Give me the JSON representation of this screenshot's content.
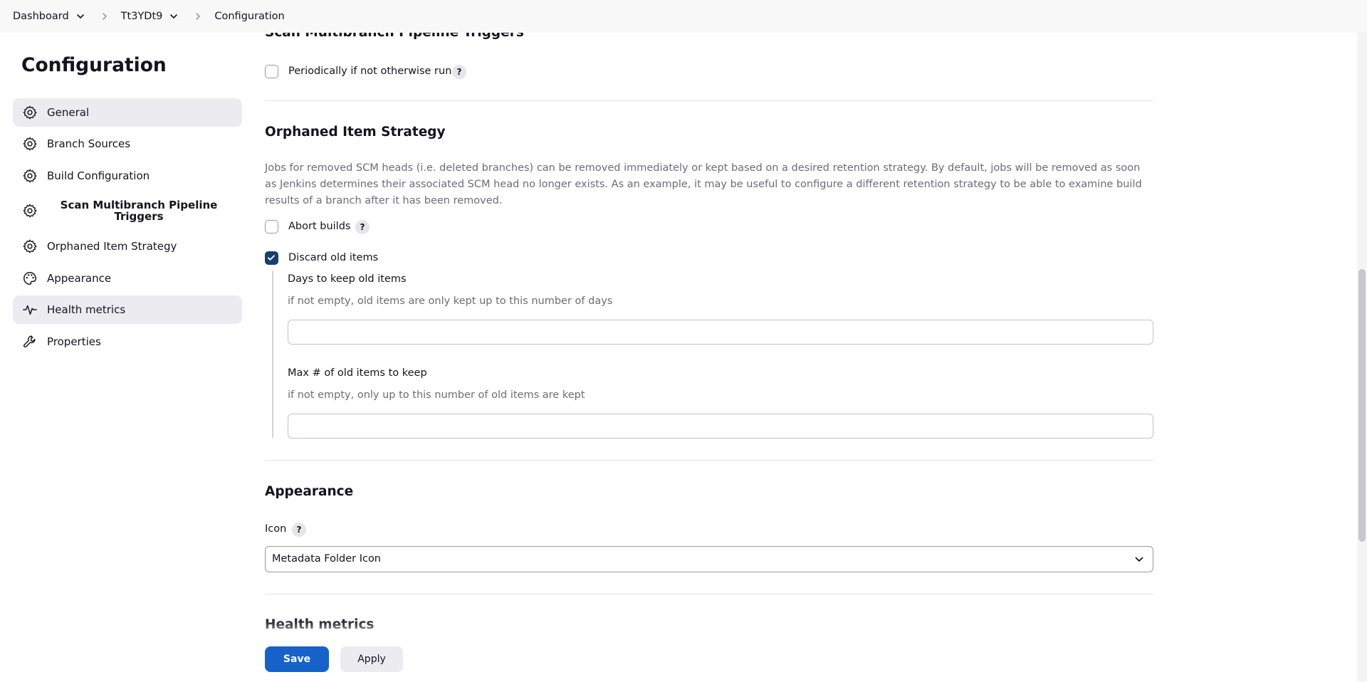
{
  "breadcrumb": {
    "items": [
      "Dashboard",
      "Tt3YDt9",
      "Configuration"
    ]
  },
  "sidebar": {
    "title": "Configuration",
    "items": [
      {
        "label": "General",
        "icon": "gear-icon"
      },
      {
        "label": "Branch Sources",
        "icon": "gear-icon"
      },
      {
        "label": "Build Configuration",
        "icon": "gear-icon"
      },
      {
        "label": "Scan Multibranch Pipeline Triggers",
        "icon": "gear-icon"
      },
      {
        "label": "Orphaned Item Strategy",
        "icon": "gear-icon"
      },
      {
        "label": "Appearance",
        "icon": "palette-icon"
      },
      {
        "label": "Health metrics",
        "icon": "pulse-icon"
      },
      {
        "label": "Properties",
        "icon": "wrench-icon"
      }
    ]
  },
  "scan_triggers": {
    "title": "Scan Multibranch Pipeline Triggers",
    "periodic_label": "Periodically if not otherwise run",
    "periodic_checked": false
  },
  "orphaned": {
    "title": "Orphaned Item Strategy",
    "description": "Jobs for removed SCM heads (i.e. deleted branches) can be removed immediately or kept based on a desired retention strategy. By default, jobs will be removed as soon as Jenkins determines their associated SCM head no longer exists. As an example, it may be useful to configure a different retention strategy to be able to examine build results of a branch after it has been removed.",
    "abort_label": "Abort builds",
    "abort_checked": false,
    "discard_label": "Discard old items",
    "discard_checked": true,
    "days_label": "Days to keep old items",
    "days_help": "if not empty, old items are only kept up to this number of days",
    "days_value": "",
    "max_label": "Max # of old items to keep",
    "max_help": "if not empty, only up to this number of old items are kept",
    "max_value": ""
  },
  "appearance": {
    "title": "Appearance",
    "icon_label": "Icon",
    "icon_value": "Metadata Folder Icon"
  },
  "health": {
    "title": "Health metrics"
  },
  "help_glyph": "?",
  "actions": {
    "save": "Save",
    "apply": "Apply"
  },
  "colors": {
    "primary": "#1762c9",
    "checked": "#1a3f6e",
    "muted_text": "#6c6c7a"
  }
}
